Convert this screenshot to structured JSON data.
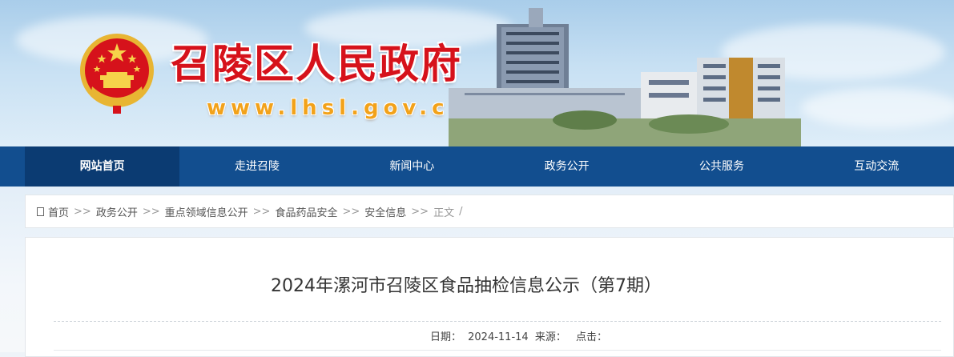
{
  "header": {
    "site_title": "召陵区人民政府",
    "site_url": "www.lhsl.gov.cn",
    "emblem": "national-emblem"
  },
  "nav": {
    "items": [
      {
        "label": "网站首页"
      },
      {
        "label": "走进召陵"
      },
      {
        "label": "新闻中心"
      },
      {
        "label": "政务公开"
      },
      {
        "label": "公共服务"
      },
      {
        "label": "互动交流"
      }
    ]
  },
  "breadcrumb": {
    "icon": "home-icon",
    "items": [
      "首页",
      "政务公开",
      "重点领域信息公开",
      "食品药品安全",
      "安全信息"
    ],
    "separator": ">>",
    "current": "正文",
    "trailing": "/"
  },
  "article": {
    "title": "2024年漯河市召陵区食品抽检信息公示（第7期）",
    "date_label": "日期：",
    "date": "2024-11-14",
    "source_label": "来源：",
    "source": "",
    "clicks_label": "点击：",
    "clicks": ""
  },
  "colors": {
    "nav_bg": "#124e8f",
    "nav_active_bg": "#0b3b72",
    "title_red": "#d6121b",
    "url_orange": "#f2a21a"
  }
}
